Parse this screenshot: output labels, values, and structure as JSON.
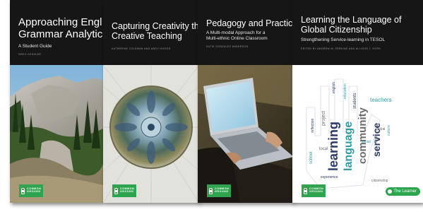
{
  "books": [
    {
      "title_lines": [
        "Approaching Engl",
        "Grammar Analytic"
      ],
      "subtitle_lines": [
        "A Student Guide"
      ],
      "editors": "GREG KESSLER",
      "publisher_lines": [
        "COMMON",
        "GROUND"
      ],
      "cover_art": "mountain-valley-photo"
    },
    {
      "title_lines": [
        "Capturing Creativity th",
        "Creative Teaching"
      ],
      "subtitle_lines": [],
      "editors": "KATHERINE COLEMAN AND ANDY HOGGS",
      "publisher_lines": [
        "COMMON",
        "GROUND"
      ],
      "cover_art": "kaleidoscope-mandala"
    },
    {
      "title_lines": [
        "Pedagogy and Practic"
      ],
      "subtitle_lines": [
        "A Multi-modal Approach for a",
        "Multi-ethnic Online Classroom"
      ],
      "editors": "KATIE GONZALEZ ANDERSON",
      "publisher_lines": [
        "COMMON",
        "GROUND"
      ],
      "cover_art": "laptop-on-lap-photo"
    },
    {
      "title_lines": [
        "Learning the Language of",
        "Global Citizenship"
      ],
      "subtitle_lines": [
        "Strengthening Service-learning in TESOL"
      ],
      "editors": "EDITED BY ANDREW M. PERKINS AND ALLISON J. HOPE",
      "publisher_lines": [
        "COMMON",
        "GROUND"
      ],
      "cover_art": "word-cloud-hand",
      "badge": "The Learner"
    }
  ],
  "word_cloud": [
    "learning",
    "language",
    "community",
    "service",
    "teachers",
    "project",
    "students",
    "school",
    "local",
    "english",
    "education",
    "global",
    "reflection",
    "social",
    "tesol",
    "experience",
    "culture",
    "citizenship"
  ],
  "colors": {
    "header": "#161616",
    "publisher_green": "#2ea44f",
    "cloud_navy": "#2b3a67",
    "cloud_teal": "#2e9ba3",
    "cloud_grey": "#6b6b6b"
  }
}
